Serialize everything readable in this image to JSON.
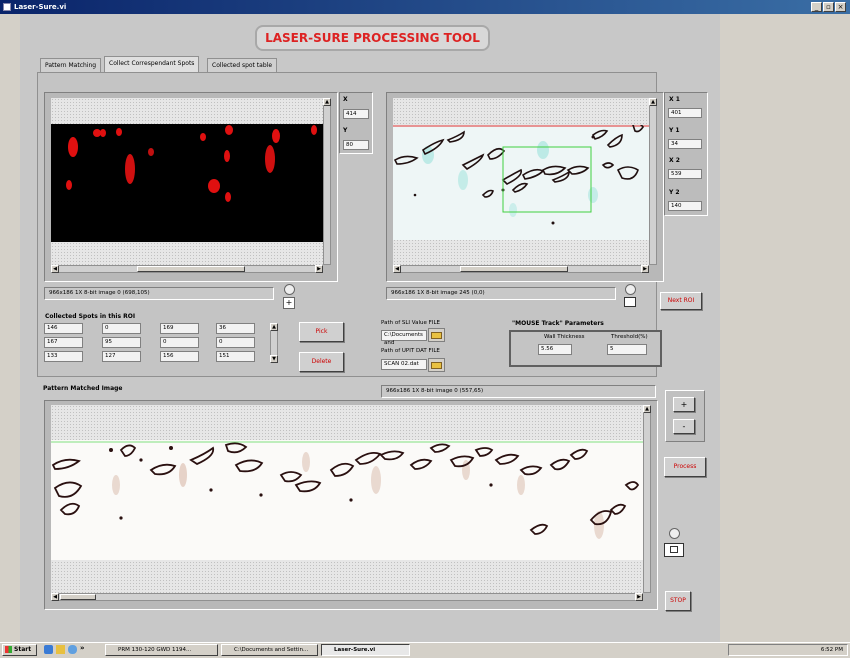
{
  "window": {
    "title": "Laser-Sure.vi",
    "controls": [
      "_",
      "▫",
      "×"
    ]
  },
  "app_title": "LASER-SURE PROCESSING TOOL",
  "tabs": [
    {
      "label": "Pattern Matching"
    },
    {
      "label": "Collect Correspendant Spots"
    },
    {
      "label": "Collected spot table"
    }
  ],
  "left_image": {
    "x_label": "X",
    "x_value": "414",
    "y_label": "Y",
    "y_value": "80",
    "info": "966x186 1X 8-bit image 0    (698,105)"
  },
  "right_image": {
    "x1_label": "X 1",
    "x1_value": "401",
    "y1_label": "Y 1",
    "y1_value": "34",
    "x2_label": "X 2",
    "x2_value": "539",
    "y2_label": "Y 2",
    "y2_value": "140",
    "info": "966x186 1X 8-bit image 245    (0,0)"
  },
  "spots": {
    "title": "Collected Spots in this ROI",
    "rows": [
      [
        "146",
        "0",
        "169",
        "36"
      ],
      [
        "167",
        "95",
        "0",
        "0"
      ],
      [
        "133",
        "127",
        "156",
        "151"
      ]
    ]
  },
  "buttons": {
    "pick": "Pick",
    "delete": "Delete",
    "next_roi": "Next ROI",
    "process": "Process",
    "stop": "STOP",
    "plus": "+",
    "minus": "-"
  },
  "paths": {
    "sli_label": "Path of SLI Value FILE",
    "sli_value": "C:\\Documents and",
    "dat_label": "Path of UPIT DAT FILE",
    "dat_value": "SCAN 02.dat"
  },
  "mouse_track": {
    "title": "\"MOUSE Track\" Parameters",
    "wall_label": "Wall Thickness",
    "wall_value": "5.56",
    "threshold_label": "Threshold(%)",
    "threshold_value": "5"
  },
  "pattern": {
    "title": "Pattern Matched Image",
    "info": "966x186 1X 8-bit image 0    (557,65)"
  },
  "taskbar": {
    "start": "Start",
    "chevron": "»",
    "items": [
      "PRM 130-120 GWD 1194...",
      "C:\\Documents and Settin...",
      "Laser-Sure.vi"
    ],
    "clock": "6:52 PM"
  }
}
